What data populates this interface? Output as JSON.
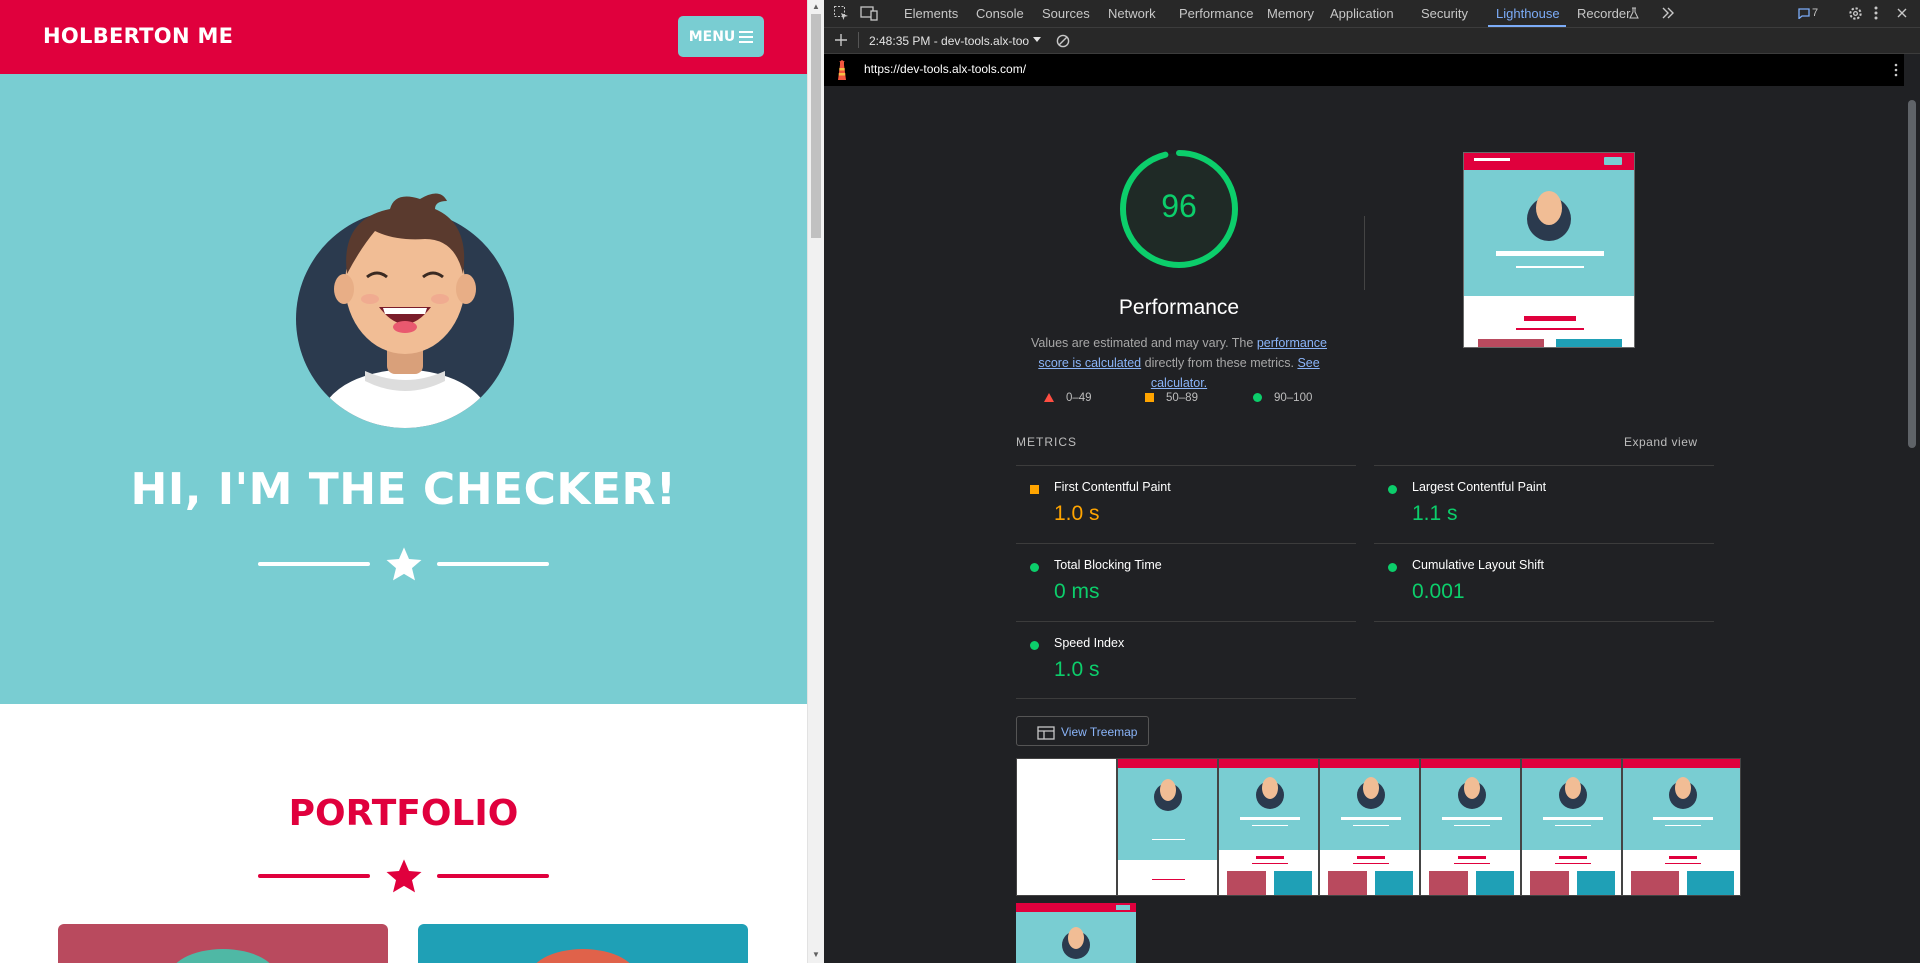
{
  "site": {
    "brand": "HOLBERTON ME",
    "menu_label": "MENU",
    "hero_title": "HI, I'M THE CHECKER!",
    "portfolio_title": "PORTFOLIO",
    "colors": {
      "primary": "#e0003d",
      "hero": "#79cdd2",
      "card1": "#b94a5e",
      "card2": "#1fa0b6"
    }
  },
  "devtools": {
    "tabs": [
      "Elements",
      "Console",
      "Sources",
      "Network",
      "Performance",
      "Memory",
      "Application",
      "Security",
      "Lighthouse",
      "Recorder"
    ],
    "active_tab": "Lighthouse",
    "issues_count": "7",
    "report_selector": "2:48:35 PM - dev-tools.alx-too",
    "url": "https://dev-tools.alx-tools.com/"
  },
  "report": {
    "score": "96",
    "category": "Performance",
    "note_prefix": "Values are estimated and may vary. The ",
    "note_link1": "performance score is calculated",
    "note_middle": " directly from these metrics. ",
    "note_link2": "See calculator.",
    "legend": {
      "fail": "0–49",
      "average": "50–89",
      "pass": "90–100"
    },
    "metrics_header": "METRICS",
    "expand_label": "Expand view",
    "metrics": [
      {
        "name": "First Contentful Paint",
        "value": "1.0 s",
        "status": "average"
      },
      {
        "name": "Largest Contentful Paint",
        "value": "1.1 s",
        "status": "pass"
      },
      {
        "name": "Total Blocking Time",
        "value": "0 ms",
        "status": "pass"
      },
      {
        "name": "Cumulative Layout Shift",
        "value": "0.001",
        "status": "pass"
      },
      {
        "name": "Speed Index",
        "value": "1.0 s",
        "status": "pass"
      }
    ],
    "treemap_label": "View Treemap",
    "status_colors": {
      "pass": "#0cce6b",
      "average": "#ffa400",
      "fail": "#ff4e42"
    }
  }
}
